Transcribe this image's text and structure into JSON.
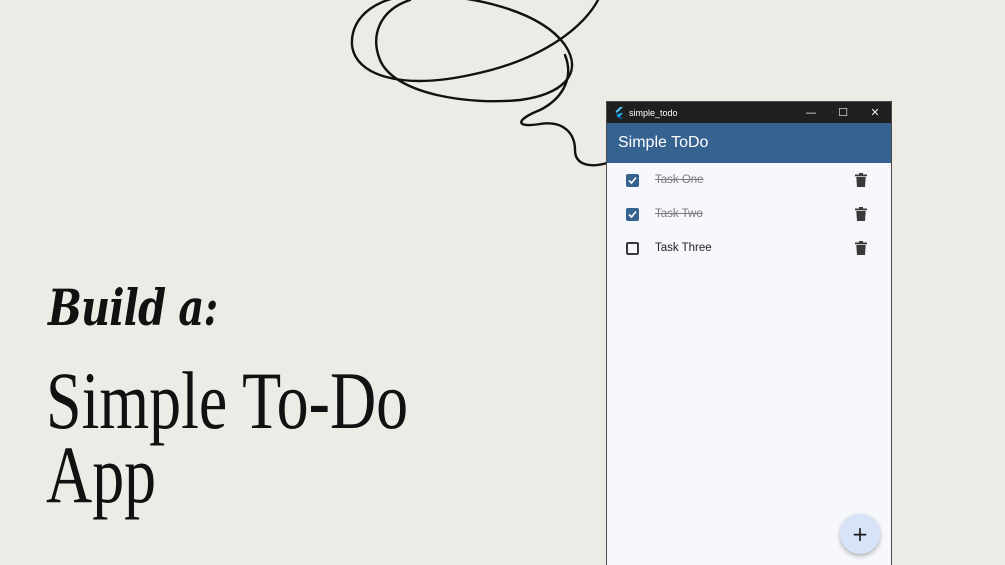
{
  "slide": {
    "line1": "Build a:",
    "line2": "Simple To-Do",
    "line3": "App"
  },
  "window": {
    "title": "simple_todo",
    "app_icon": "flutter-logo-icon",
    "controls": {
      "minimize": "—",
      "maximize": "☐",
      "close": "✕"
    }
  },
  "appbar": {
    "title": "Simple ToDo"
  },
  "tasks": [
    {
      "label": "Task One",
      "done": true
    },
    {
      "label": "Task Two",
      "done": true
    },
    {
      "label": "Task Three",
      "done": false
    }
  ],
  "fab": {
    "label": "+",
    "icon": "add-icon"
  },
  "colors": {
    "background": "#ecebe6",
    "appbar": "#35628f",
    "checkbox": "#35628f",
    "fab": "#d7e3f8",
    "titlebar": "#1f1f1f"
  }
}
